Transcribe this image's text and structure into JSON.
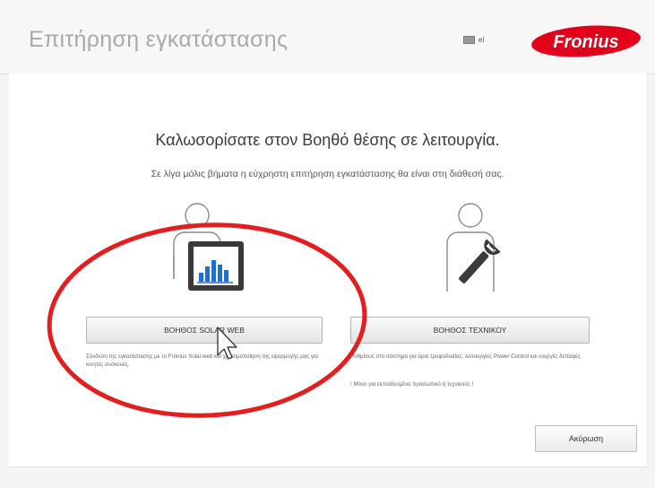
{
  "header": {
    "title": "Επιτήρηση εγκατάστασης",
    "language": "el",
    "logo_text": "Fronius"
  },
  "main": {
    "welcome_title": "Καλωσορίσατε στον Βοηθό θέσης σε λειτουργία.",
    "subtitle": "Σε λίγα μόλις βήματα η εύχρηστη επιτήρηση εγκατάστασης θα είναι στη διάθεσή σας.",
    "solar_web": {
      "button_label": "ΒΟΗΘΟΣ SOLAR WEB",
      "description": "Σύνδεση της εγκατάστασης με το Fronius Solar.web και χρησιμοποίηση της εφαρμογής μας για κινητές συσκευές."
    },
    "technician": {
      "button_label": "ΒΟΗΘΟΣ ΤΕΧΝΙΚΟΥ",
      "description": "Ρυθμίσεις στο σύστημα για άριο τροφοδοσίας, λειτουργίες Power Control και ενεργές δεπαφές",
      "warning": "! Μόνο για εκπαιδευμένο προσωπικό ή τεχνικούς !"
    },
    "cancel_label": "Ακύρωση"
  },
  "colors": {
    "brand_red": "#e2001a",
    "annotation_red": "#e41e1e",
    "chart_blue": "#1e6fd0"
  },
  "icons": {
    "solar_wizard": "person-with-chart-icon",
    "technician_wizard": "person-with-wrench-icon",
    "cursor": "mouse-pointer-icon"
  }
}
